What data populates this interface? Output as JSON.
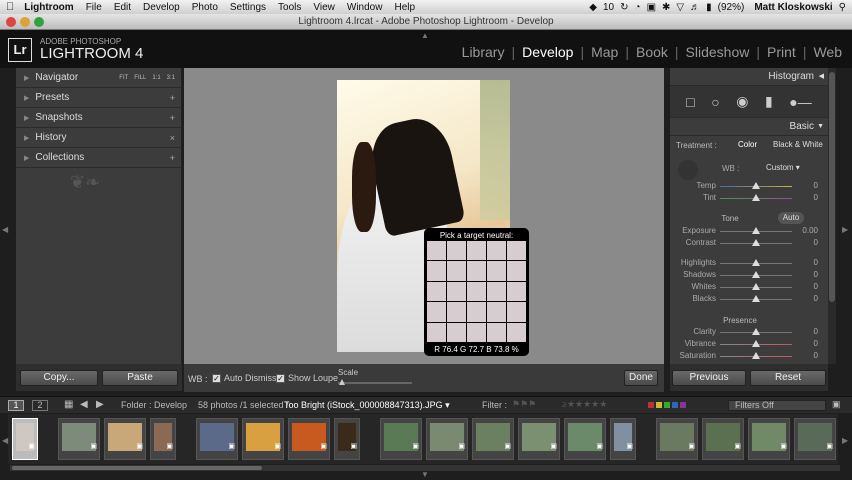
{
  "menubar": {
    "app": "Lightroom",
    "items": [
      "File",
      "Edit",
      "Develop",
      "Photo",
      "Settings",
      "Tools",
      "View",
      "Window",
      "Help"
    ],
    "status_badge": "10",
    "battery": "(92%)",
    "user": "Matt Kloskowski"
  },
  "window": {
    "title": "Lightroom 4.lrcat - Adobe Photoshop Lightroom - Develop"
  },
  "branding": {
    "logo": "Lr",
    "adobe": "ADOBE PHOTOSHOP",
    "product": "LIGHTROOM 4"
  },
  "modules": [
    {
      "label": "Library"
    },
    {
      "label": "Develop"
    },
    {
      "label": "Map"
    },
    {
      "label": "Book"
    },
    {
      "label": "Slideshow"
    },
    {
      "label": "Print"
    },
    {
      "label": "Web"
    }
  ],
  "active_module": "Develop",
  "left_panel": {
    "navigator": {
      "label": "Navigator",
      "zoom_options": [
        "FIT",
        "FILL",
        "1:1",
        "3:1"
      ]
    },
    "sections": [
      {
        "label": "Presets",
        "action": "+"
      },
      {
        "label": "Snapshots",
        "action": "+"
      },
      {
        "label": "History",
        "action": "×"
      },
      {
        "label": "Collections",
        "action": "+"
      }
    ],
    "copy_label": "Copy...",
    "paste_label": "Paste"
  },
  "loupe": {
    "title": "Pick a target neutral:",
    "readout": "R 76.4  G 72.7  B 73.8  %"
  },
  "toolbar": {
    "wb_label": "WB :",
    "auto_dismiss": "Auto Dismiss",
    "show_loupe": "Show Loupe",
    "scale_label": "Scale",
    "done_label": "Done"
  },
  "right_panel": {
    "histogram_label": "Histogram",
    "basic_label": "Basic",
    "treatment_label": "Treatment :",
    "color_label": "Color",
    "bw_label": "Black & White",
    "wb_label": "WB :",
    "wb_value": "Custom",
    "tone_label": "Tone",
    "auto_label": "Auto",
    "presence_label": "Presence",
    "sliders": [
      {
        "label": "Temp",
        "value": "0"
      },
      {
        "label": "Tint",
        "value": "0"
      },
      {
        "label": "Exposure",
        "value": "0.00"
      },
      {
        "label": "Contrast",
        "value": "0"
      },
      {
        "label": "Highlights",
        "value": "0"
      },
      {
        "label": "Shadows",
        "value": "0"
      },
      {
        "label": "Whites",
        "value": "0"
      },
      {
        "label": "Blacks",
        "value": "0"
      },
      {
        "label": "Clarity",
        "value": "0"
      },
      {
        "label": "Vibrance",
        "value": "0"
      },
      {
        "label": "Saturation",
        "value": "0"
      }
    ],
    "previous_label": "Previous",
    "reset_label": "Reset"
  },
  "filmstrip_bar": {
    "view1": "1",
    "view2": "2",
    "folder_label": "Folder : Develop",
    "count": "58 photos /1 selected /",
    "filename": "Too Bright (iStock_000008847313).JPG",
    "filter_label": "Filter :",
    "filters_off": "Filters Off"
  },
  "thumb_colors": [
    "#cfc7c0",
    "#7c8b7a",
    "#c8a878",
    "#8a6a55",
    "#5a6a88",
    "#d8a040",
    "#c85a20",
    "#3a2a1a",
    "#5a7a55",
    "#7a8a70",
    "#6a8060",
    "#7a9070",
    "#6a8a6a",
    "#8090a0",
    "#6a7a60",
    "#5a7050",
    "#708a68",
    "#5a6a58"
  ]
}
